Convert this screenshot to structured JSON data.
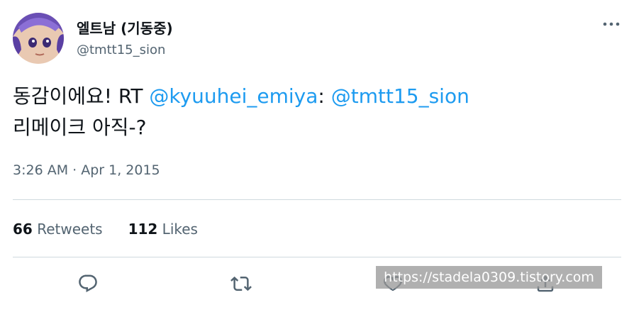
{
  "author": {
    "display_name": "엘트남 (기동중)",
    "handle": "@tmtt15_sion",
    "avatar_icon": "anime-avatar"
  },
  "tweet": {
    "text_part1": "동감이에요! RT ",
    "mention1": "@kyuuhei_emiya",
    "text_part2": ": ",
    "mention2": "@tmtt15_sion",
    "line2": "리메이크 아직-?",
    "timestamp": "3:26 AM · Apr 1, 2015"
  },
  "stats": {
    "retweets_count": "66",
    "retweets_label": " Retweets",
    "likes_count": "112",
    "likes_label": " Likes"
  },
  "actions": [
    "reply-icon",
    "retweet-icon",
    "like-icon",
    "share-icon"
  ],
  "watermark": "https://stadela0309.tistory.com",
  "colors": {
    "link": "#1d9bf0",
    "text": "#0f1419",
    "secondary": "#536471",
    "divider": "#cfd9de"
  }
}
